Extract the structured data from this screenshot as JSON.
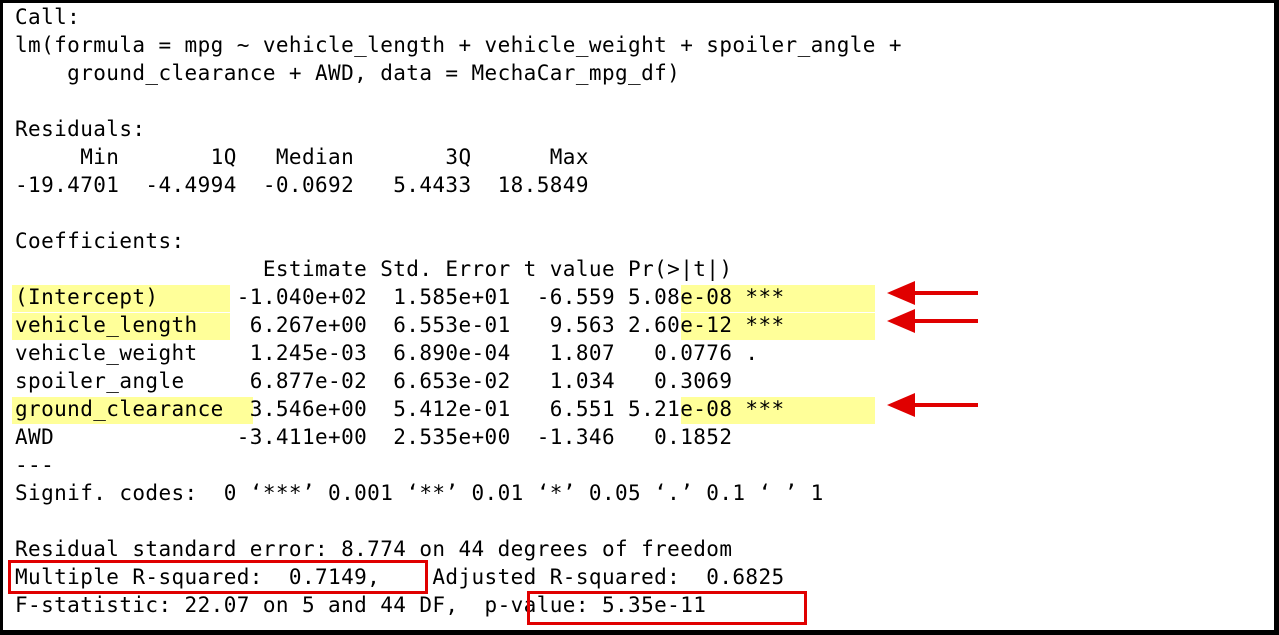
{
  "output": {
    "lines": [
      "Call:",
      "lm(formula = mpg ~ vehicle_length + vehicle_weight + spoiler_angle +",
      "    ground_clearance + AWD, data = MechaCar_mpg_df)",
      "",
      "Residuals:",
      "     Min       1Q   Median       3Q      Max",
      "-19.4701  -4.4994  -0.0692   5.4433  18.5849",
      "",
      "Coefficients:",
      "                   Estimate Std. Error t value Pr(>|t|)",
      "(Intercept)      -1.040e+02  1.585e+01  -6.559 5.08e-08 ***",
      "vehicle_length    6.267e+00  6.553e-01   9.563 2.60e-12 ***",
      "vehicle_weight    1.245e-03  6.890e-04   1.807   0.0776 .",
      "spoiler_angle     6.877e-02  6.653e-02   1.034   0.3069",
      "ground_clearance  3.546e+00  5.412e-01   6.551 5.21e-08 ***",
      "AWD              -3.411e+00  2.535e+00  -1.346   0.1852",
      "---",
      "Signif. codes:  0 ‘***’ 0.001 ‘**’ 0.01 ‘*’ 0.05 ‘.’ 0.1 ‘ ’ 1",
      "",
      "Residual standard error: 8.774 on 44 degrees of freedom",
      "Multiple R-squared:  0.7149,    Adjusted R-squared:  0.6825",
      "F-statistic: 22.07 on 5 and 44 DF,  p-value: 5.35e-11"
    ]
  },
  "colors": {
    "highlight": "#ffff99",
    "annotation": "#e00000",
    "border": "#000000"
  },
  "icons": [
    "arrow-left-icon"
  ]
}
